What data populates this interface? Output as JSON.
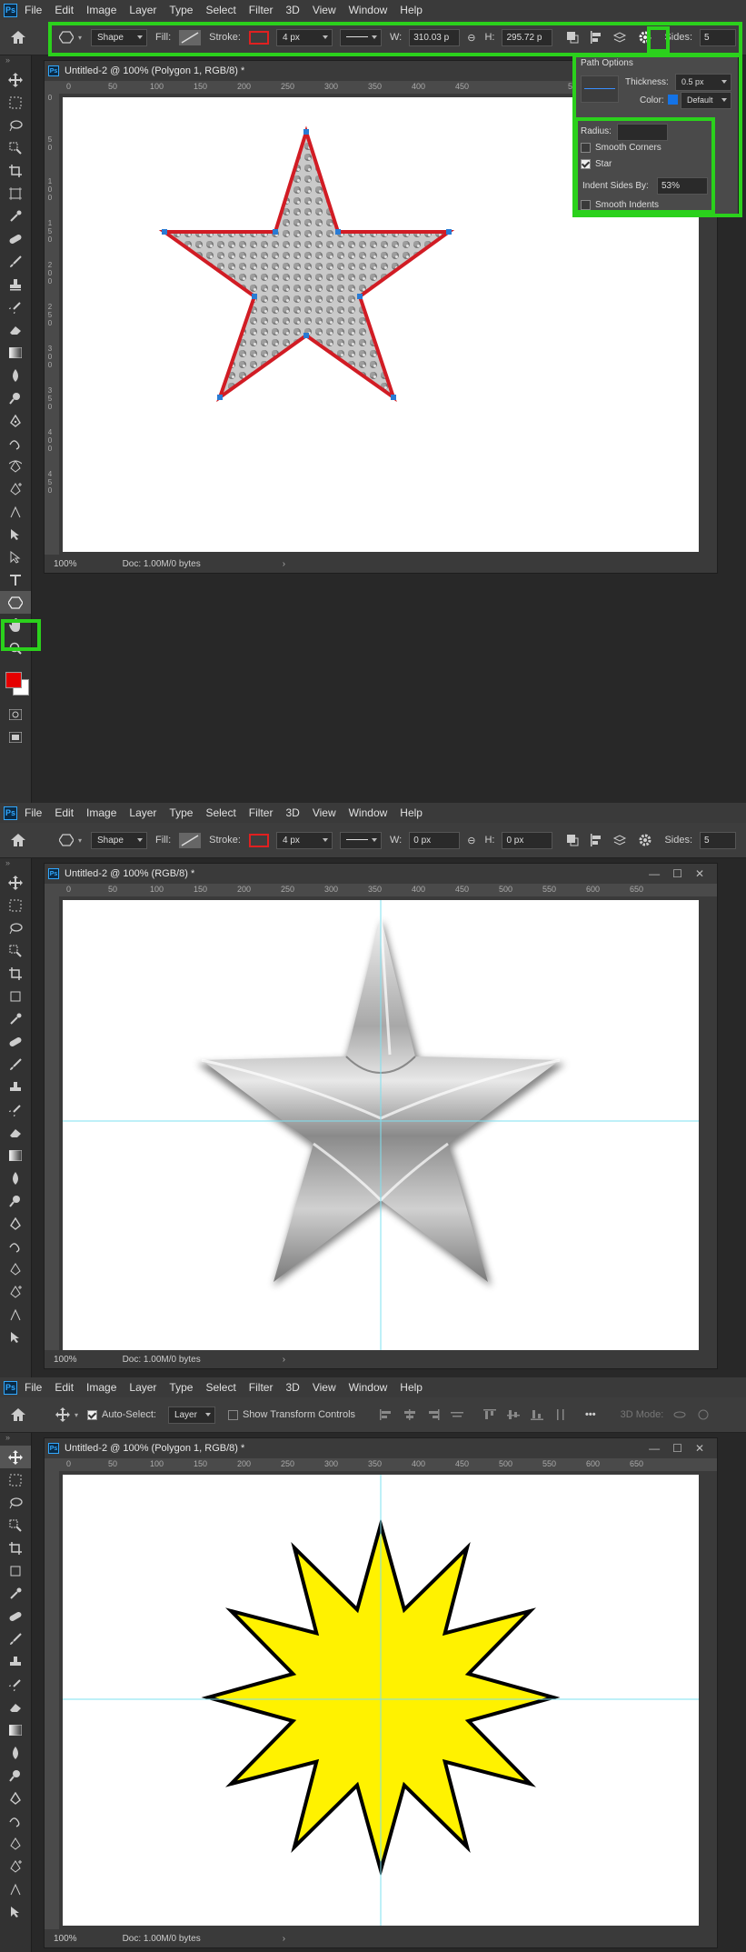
{
  "menu": [
    "File",
    "Edit",
    "Image",
    "Layer",
    "Type",
    "Select",
    "Filter",
    "3D",
    "View",
    "Window",
    "Help"
  ],
  "panel1": {
    "options": {
      "mode": "Shape",
      "fill_label": "Fill:",
      "stroke_label": "Stroke:",
      "stroke_width": "4 px",
      "w_label": "W:",
      "w_value": "310.03 p",
      "h_label": "H:",
      "h_value": "295.72 p",
      "sides_label": "Sides:",
      "sides_value": "5"
    },
    "doc_title": "Untitled-2 @ 100% (Polygon 1, RGB/8) *",
    "zoom": "100%",
    "doc_size": "Doc: 1.00M/0 bytes",
    "ruler_h": [
      "0",
      "50",
      "100",
      "150",
      "200",
      "250",
      "300",
      "350",
      "400",
      "450",
      "50"
    ],
    "ruler_v": [
      "0",
      "5 0",
      "1 0 0",
      "1 5 0",
      "2 0 0",
      "2 5 0",
      "3 0 0",
      "3 5 0",
      "4 0 0",
      "4 5 0"
    ],
    "popup": {
      "title": "Path Options",
      "thickness_label": "Thickness:",
      "thickness_value": "0.5 px",
      "color_label": "Color:",
      "color_value": "Default",
      "radius_label": "Radius:",
      "smooth_corners": "Smooth Corners",
      "star": "Star",
      "indent_label": "Indent Sides By:",
      "indent_value": "53%",
      "smooth_indents": "Smooth Indents"
    }
  },
  "panel2": {
    "options": {
      "mode": "Shape",
      "fill_label": "Fill:",
      "stroke_label": "Stroke:",
      "stroke_width": "4 px",
      "w_label": "W:",
      "w_value": "0 px",
      "h_label": "H:",
      "h_value": "0 px",
      "sides_label": "Sides:",
      "sides_value": "5"
    },
    "doc_title": "Untitled-2 @ 100% (RGB/8) *",
    "zoom": "100%",
    "doc_size": "Doc: 1.00M/0 bytes",
    "ruler_h": [
      "0",
      "50",
      "100",
      "150",
      "200",
      "250",
      "300",
      "350",
      "400",
      "450",
      "500",
      "550",
      "600",
      "650"
    ]
  },
  "panel3": {
    "options": {
      "auto_select": "Auto-Select:",
      "layer": "Layer",
      "show_transform": "Show Transform Controls",
      "mode_3d": "3D Mode:"
    },
    "doc_title": "Untitled-2 @ 100% (Polygon 1, RGB/8) *",
    "zoom": "100%",
    "doc_size": "Doc: 1.00M/0 bytes",
    "ruler_h": [
      "0",
      "50",
      "100",
      "150",
      "200",
      "250",
      "300",
      "350",
      "400",
      "450",
      "500",
      "550",
      "600",
      "650"
    ]
  },
  "colors": {
    "highlight": "#2bd11c",
    "stroke": "#e02020",
    "star_fill_yellow": "#fff200",
    "guide": "#7ee0f0"
  }
}
